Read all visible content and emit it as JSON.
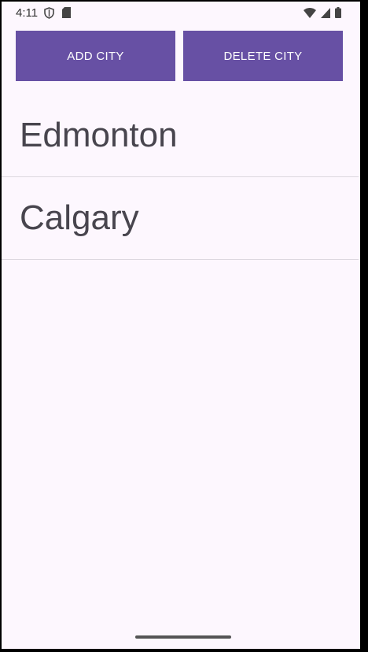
{
  "status_bar": {
    "time": "4:11",
    "left_icons": [
      "shield-icon",
      "sd-card-icon"
    ],
    "right_icons": [
      "wifi-icon",
      "signal-icon",
      "battery-icon"
    ]
  },
  "actions": {
    "add_label": "ADD CITY",
    "delete_label": "DELETE CITY",
    "button_color": "#6750a4"
  },
  "city_list": {
    "items": [
      "Edmonton",
      "Calgary"
    ]
  },
  "theme": {
    "background": "#fdf7fe",
    "text_color": "#48454e",
    "divider_color": "#ddd8e0"
  }
}
